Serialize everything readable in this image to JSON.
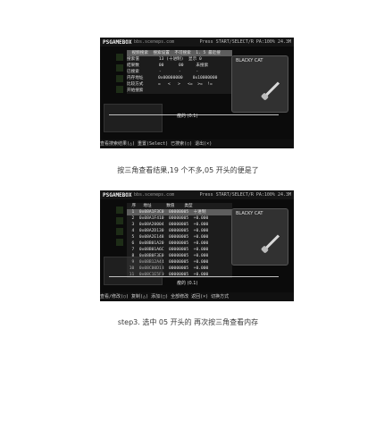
{
  "screens": [
    {
      "logo": "PSGAMEBOX",
      "url": "bbs.sceneps.com",
      "meta": "Press START/SELECT/R    PA:100%  24.3M",
      "rows": [
        "  视频搜索  搜索设置  不可搜索  1. 5 最近搜",
        "搜索值        13 (十进制)  显示 0",
        "结果数        00      00     未搜索",
        "已搜索        -       -      -",
        "内存地址      0x00000000    0x10000000",
        "比较方式      =   <   >   <=  >=  !=",
        "开始搜索"
      ],
      "card_title": "BLACKY CAT",
      "bottom_tag": "瘦的 (0.1)",
      "footer": "查看搜索结果(△)  重置(Select)  已搜索(○)  退出(×)"
    },
    {
      "logo": "PSGAMEBOX",
      "url": "bbs.sceneps.com",
      "meta": "Press START/SELECT/R    PA:100%  24.3M",
      "rows": [
        "  序   地址      数值    类型",
        "  1  0x08A1F3C0  00000005  十进制",
        "  2  0x08A1F410  00000005  +0.000",
        "  3  0x08A20004  00000005  +0.000",
        "  4  0x08A2D130  00000005  +0.000",
        "  5  0x08A2E148  00000005  +0.000",
        "  6  0x08B01A20  00000005  +0.000",
        "  7  0x08B01A6C  00000005  +0.000",
        "  8  0x08B0F3E0  00000005  +0.000",
        "  9  0x08B12A44  00000005  +0.000",
        " 10  0x08C00D18  00000005  +0.000",
        " 11  0x08C1E5F0  00000005  +0.000"
      ],
      "card_title": "BLACKY CAT",
      "bottom_tag": "瘦的 (0.1)",
      "footer": "查看/修改(○)  复制(△)  添加(□)  全部修改  返回(×)  切换方式"
    }
  ],
  "captions": [
    "按三角查看结果,19 个不多,05 开头的便是了",
    "step3. 选中 05 开头的  再次按三角查看内存"
  ]
}
